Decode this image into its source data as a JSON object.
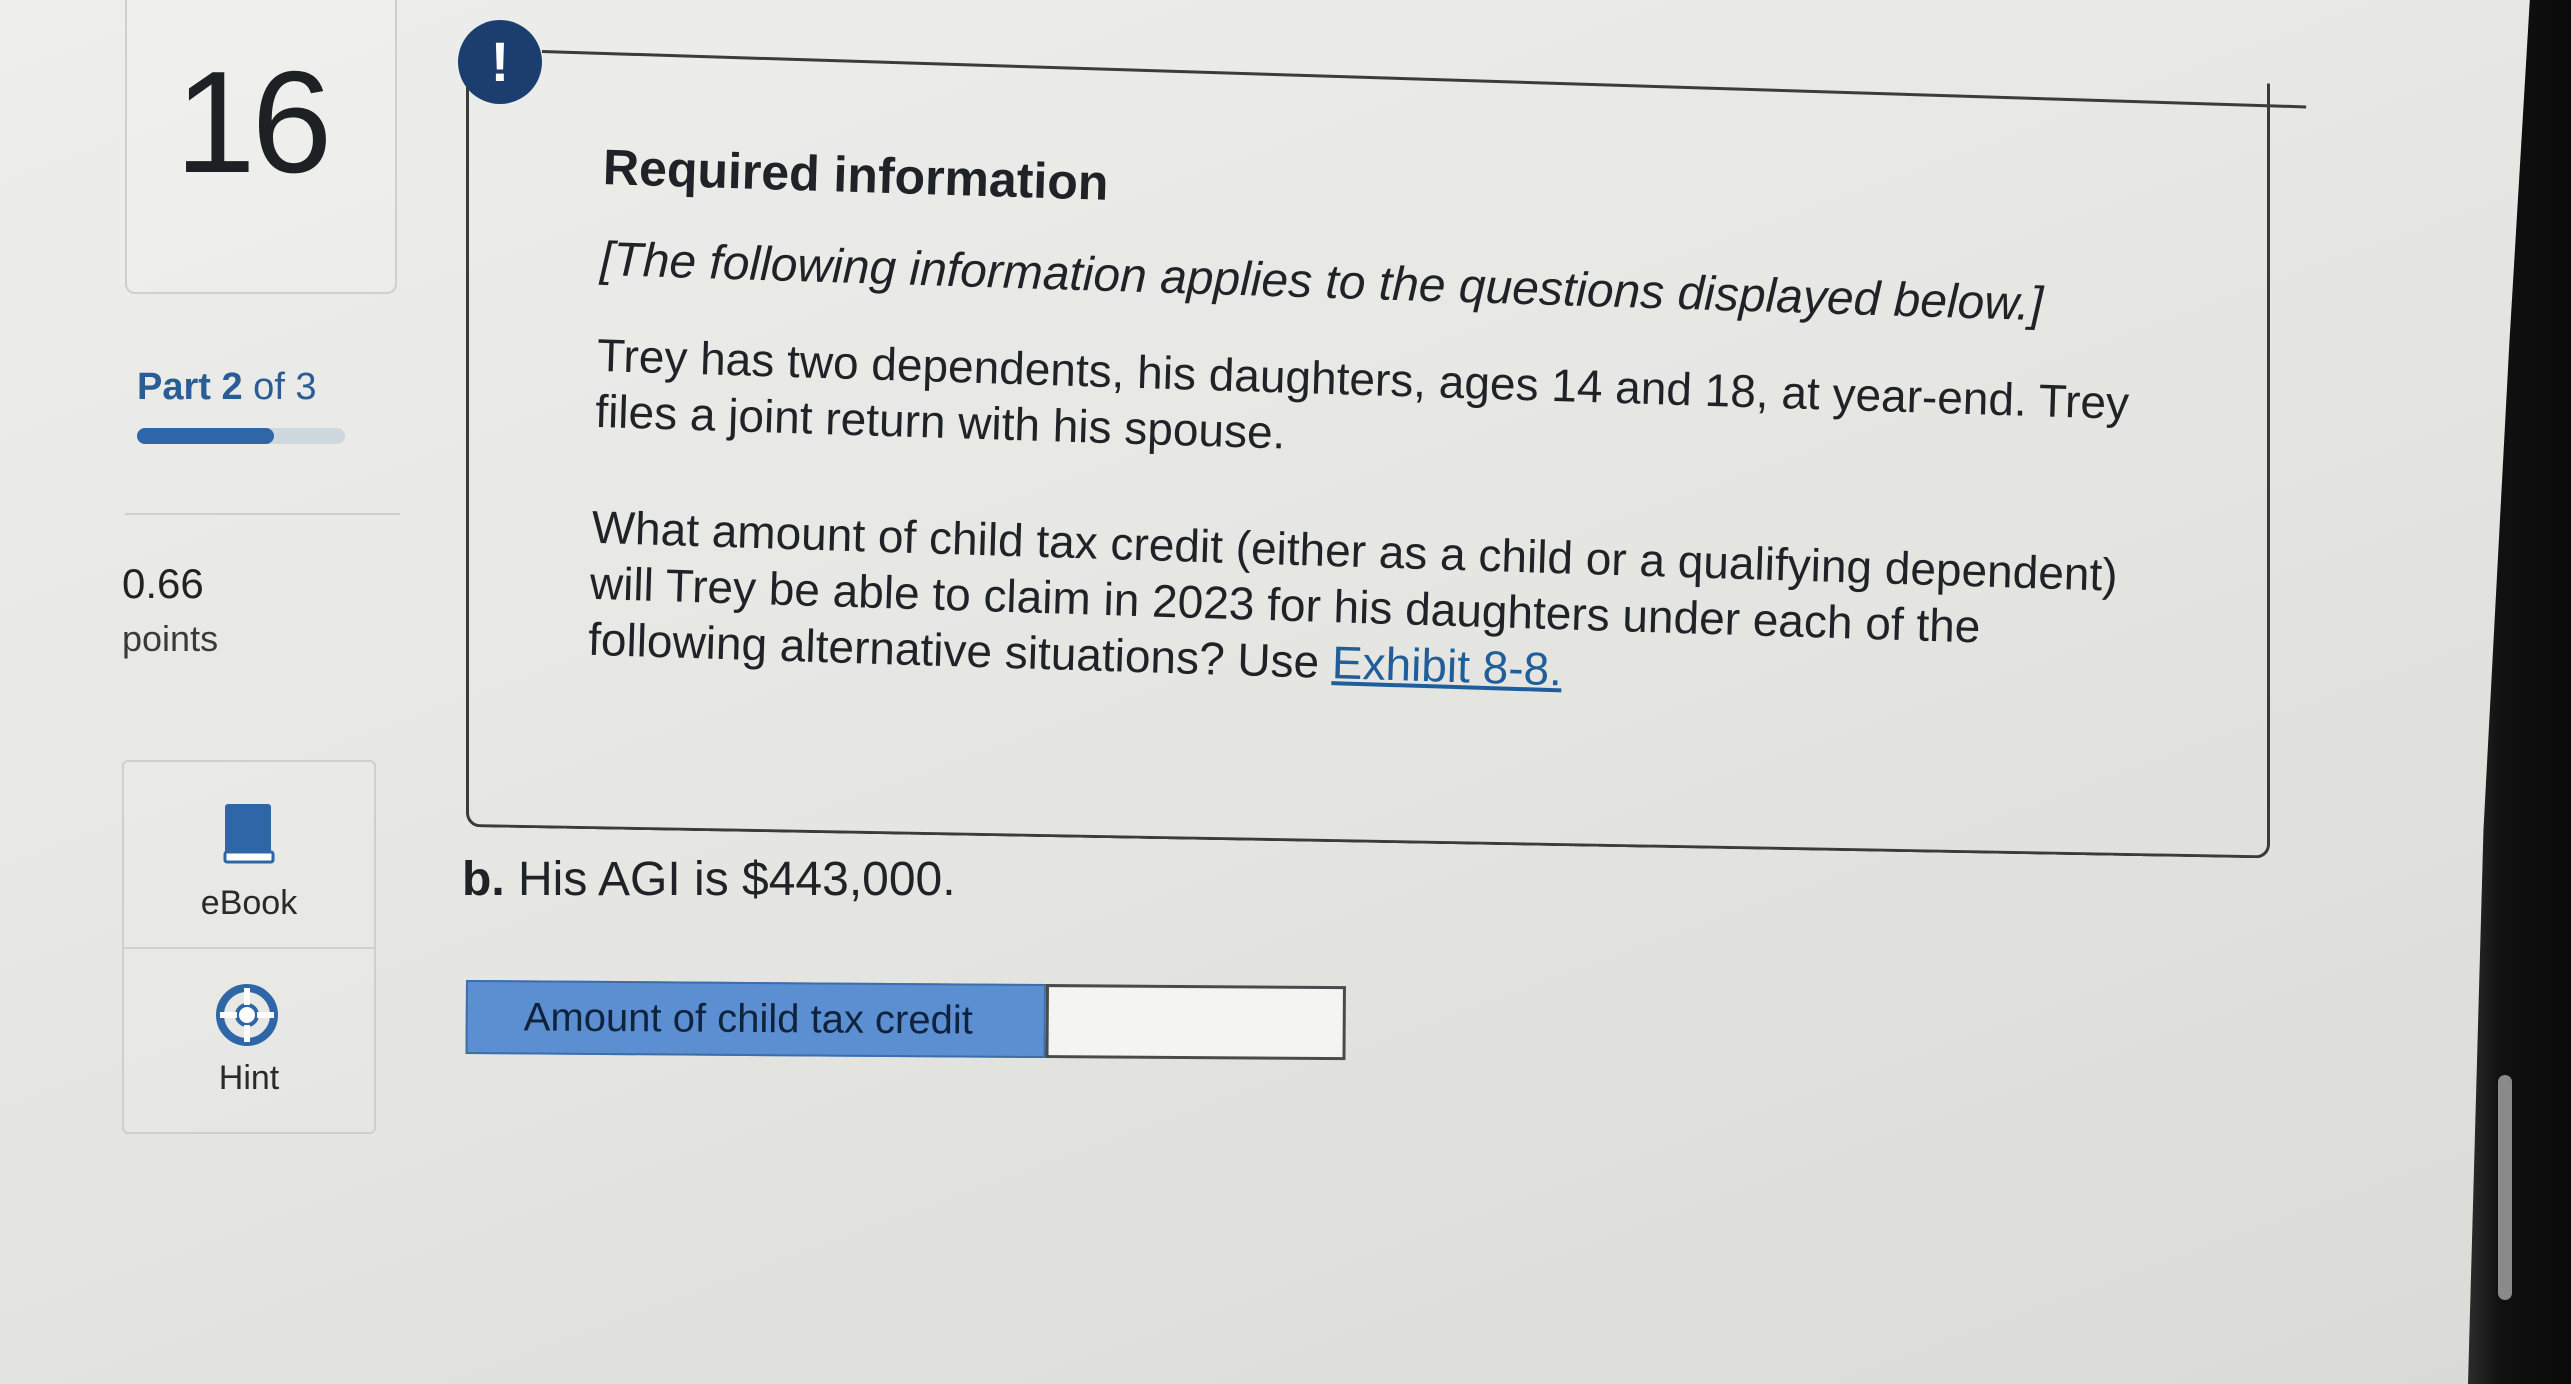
{
  "sidebar": {
    "question_number": "16",
    "part": {
      "prefix": "Part 2",
      "suffix": " of 3",
      "progress": 0.66
    },
    "points_value": "0.66",
    "points_label": "points",
    "tools": [
      {
        "label": "eBook",
        "icon": "book-icon"
      },
      {
        "label": "Hint",
        "icon": "lifebuoy-icon"
      }
    ]
  },
  "alert": {
    "glyph": "!"
  },
  "info": {
    "title": "Required information",
    "note": "[The following information applies to the questions displayed below.]",
    "paragraph1": "Trey has two dependents, his daughters, ages 14 and 18, at year-end. Trey files a joint return with his spouse.",
    "paragraph2": "What amount of child tax credit (either as a child or a qualifying dependent) will Trey be able to claim in 2023 for his daughters under each of the following alternative situations? Use ",
    "link_text": "Exhibit 8-8."
  },
  "question": {
    "label": "b.",
    "text": " His AGI is $443,000."
  },
  "answer": {
    "label": "Amount of child tax credit",
    "value": ""
  },
  "colors": {
    "accent_blue": "#2f66a8",
    "answer_label_bg": "#5b8fd2",
    "badge_bg": "#1c3e6e",
    "link": "#1f5e9a"
  }
}
